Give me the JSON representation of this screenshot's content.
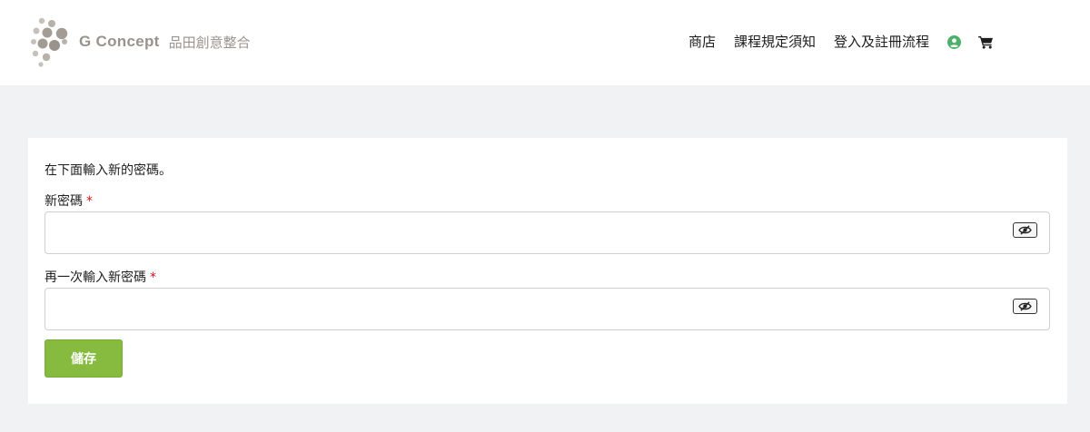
{
  "brand": {
    "name": "G Concept",
    "subtitle": "品田創意整合"
  },
  "nav": {
    "items": [
      {
        "label": "商店"
      },
      {
        "label": "課程規定須知"
      },
      {
        "label": "登入及註冊流程"
      }
    ],
    "icons": {
      "account": "user-circle-icon",
      "cart": "shopping-cart-icon"
    },
    "account_icon_color": "#4caf6a"
  },
  "form": {
    "intro": "在下面輸入新的密碼。",
    "new_password_label": "新密碼",
    "confirm_password_label": "再一次輸入新密碼",
    "required_mark": "*",
    "new_password_value": "",
    "confirm_password_value": "",
    "save_label": "儲存",
    "toggle_icon": "eye-slash-icon"
  },
  "colors": {
    "accent": "#87bb3f",
    "required": "#d4141c",
    "brand_text": "#9a938d",
    "page_bg": "#f1f2f4"
  }
}
